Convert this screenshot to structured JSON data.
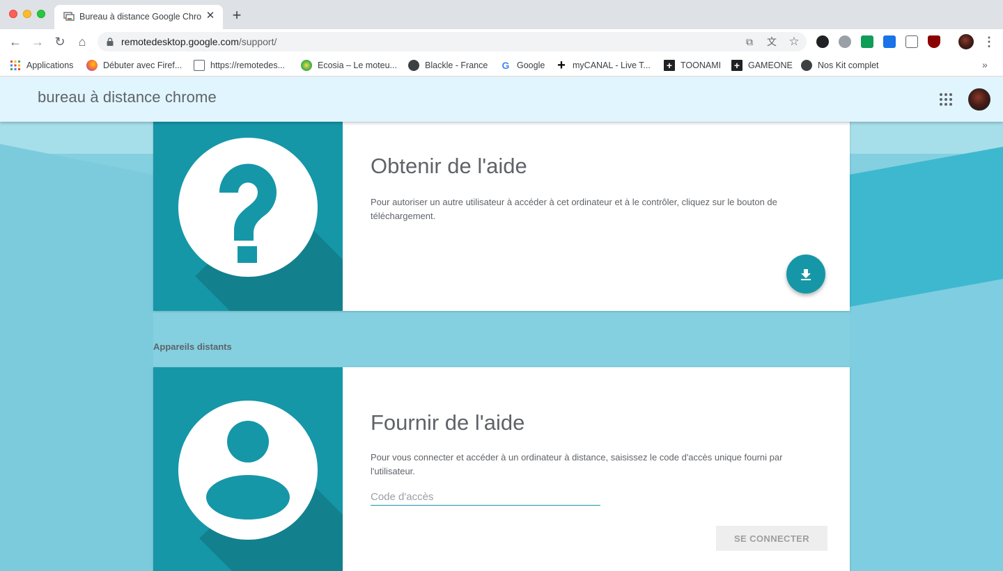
{
  "browser": {
    "tab_title": "Bureau à distance Google Chrome",
    "tab_close": "✕",
    "new_tab": "+",
    "url_host": "remotedesktop.google.com",
    "url_path": "/support/",
    "nav": {
      "back": "←",
      "forward": "→",
      "reload": "↻",
      "home": "⌂"
    },
    "omnibox_icons": {
      "open": "⧉",
      "translate": "文",
      "star": "☆"
    },
    "menu": "⋮",
    "bookmarks": [
      {
        "label": "Applications",
        "icon": "apps-icon",
        "color": "#4285f4"
      },
      {
        "label": "Débuter avec Firef...",
        "icon": "firefox-icon",
        "color": "#e66000"
      },
      {
        "label": "https://remotedes...",
        "icon": "remote-desktop-icon",
        "color": "#5f6368"
      },
      {
        "label": "Ecosia – Le moteu...",
        "icon": "ecosia-icon",
        "color": "#4fb848"
      },
      {
        "label": "Blackle - France",
        "icon": "globe-icon",
        "color": "#3c4043"
      },
      {
        "label": "Google",
        "icon": "google-icon",
        "color": "#4285f4"
      },
      {
        "label": "myCANAL - Live T...",
        "icon": "plus-icon",
        "color": "#000000"
      },
      {
        "label": "TOONAMI",
        "icon": "plus-box-icon",
        "color": "#202124"
      },
      {
        "label": "GAMEONE",
        "icon": "plus-box-icon",
        "color": "#202124"
      },
      {
        "label": "Nos Kit complet",
        "icon": "globe-icon",
        "color": "#3c4043"
      }
    ],
    "bookmarks_more": "»"
  },
  "app": {
    "title": "bureau à distance chrome",
    "accent": "#1597a8",
    "appbar_bg": "#e1f5fe"
  },
  "get_help": {
    "title": "Obtenir de l'aide",
    "description": "Pour autoriser un autre utilisateur à accéder à cet ordinateur et à le contrôler, cliquez sur le bouton de téléchargement."
  },
  "remote_section_label": "Appareils distants",
  "give_help": {
    "title": "Fournir de l'aide",
    "description": "Pour vous connecter et accéder à un ordinateur à distance, saisissez le code d'accès unique fourni par l'utilisateur.",
    "code_placeholder": "Code d'accès",
    "code_value": "",
    "connect_label": "SE CONNECTER"
  }
}
